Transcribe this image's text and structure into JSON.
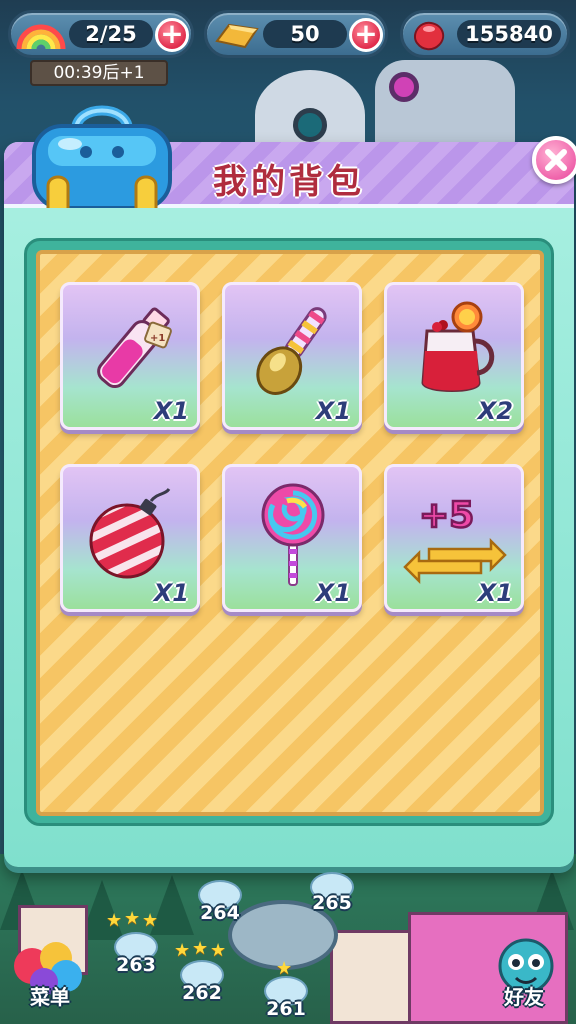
{
  "status_bar": {
    "lives": {
      "icon": "rainbow-icon",
      "value": "2/25"
    },
    "gold": {
      "icon": "gold-bar-icon",
      "value": "50"
    },
    "beans": {
      "icon": "jelly-bean-icon",
      "value": "155840"
    },
    "life_timer": "00:39后+1"
  },
  "dialog": {
    "title": "我的背包",
    "icon": "backpack-icon"
  },
  "inventory": [
    {
      "icon": "potion-bottle-icon",
      "quantity": "X1"
    },
    {
      "icon": "candy-spoon-icon",
      "quantity": "X1"
    },
    {
      "icon": "juice-pitcher-icon",
      "quantity": "X2"
    },
    {
      "icon": "striped-candy-bomb-icon",
      "quantity": "X1"
    },
    {
      "icon": "lollipop-icon",
      "quantity": "X1"
    },
    {
      "icon": "plus-five-moves-icon",
      "quantity": "X1",
      "badge": "+5"
    }
  ],
  "map": {
    "levels": [
      "264",
      "265",
      "263",
      "262",
      "261"
    ]
  },
  "bottom_nav": {
    "menu_label": "菜单",
    "friends_label": "好友"
  }
}
